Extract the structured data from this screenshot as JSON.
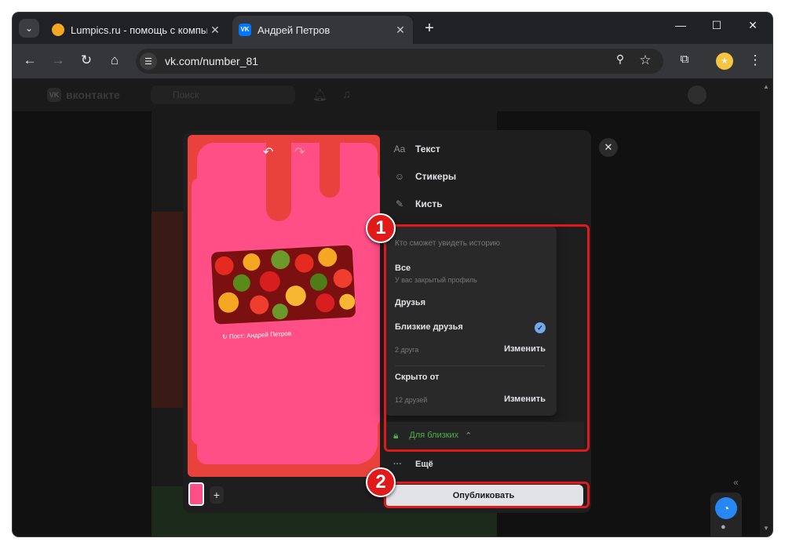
{
  "browser": {
    "tabs": [
      {
        "title": "Lumpics.ru - помощь с компьют",
        "favicon_color": "#f5a623",
        "active": false
      },
      {
        "title": "Андрей Петров",
        "favicon_color": "#0077ff",
        "active": true
      }
    ],
    "url": "vk.com/number_81"
  },
  "vk": {
    "brand": "вконтакте",
    "search_placeholder": "Поиск"
  },
  "story_editor": {
    "post_label": "Пост: Андрей Петров",
    "tools": [
      {
        "icon": "Aa",
        "label": "Текст"
      },
      {
        "icon": "☺",
        "label": "Стикеры"
      },
      {
        "icon": "✎",
        "label": "Кисть"
      }
    ],
    "visibility_popup": {
      "header": "Кто сможет увидеть историю",
      "options": [
        {
          "title": "Все",
          "subtitle": "У вас закрытый профиль"
        },
        {
          "title": "Друзья"
        },
        {
          "title": "Близкие друзья",
          "selected": true,
          "count": "2 друга",
          "action": "Изменить"
        },
        {
          "title": "Скрыто от",
          "count": "12 друзей",
          "action": "Изменить"
        }
      ]
    },
    "privacy_label": "Для близких",
    "more_label": "Ещё",
    "publish_label": "Опубликовать"
  },
  "annotations": {
    "badge1": "1",
    "badge2": "2",
    "color": "#e01a1a"
  },
  "colors": {
    "canvas_bg": "#e9413c",
    "brush": "#ff4f86",
    "accent_green": "#4bb34b",
    "check_blue": "#71aaeb"
  }
}
